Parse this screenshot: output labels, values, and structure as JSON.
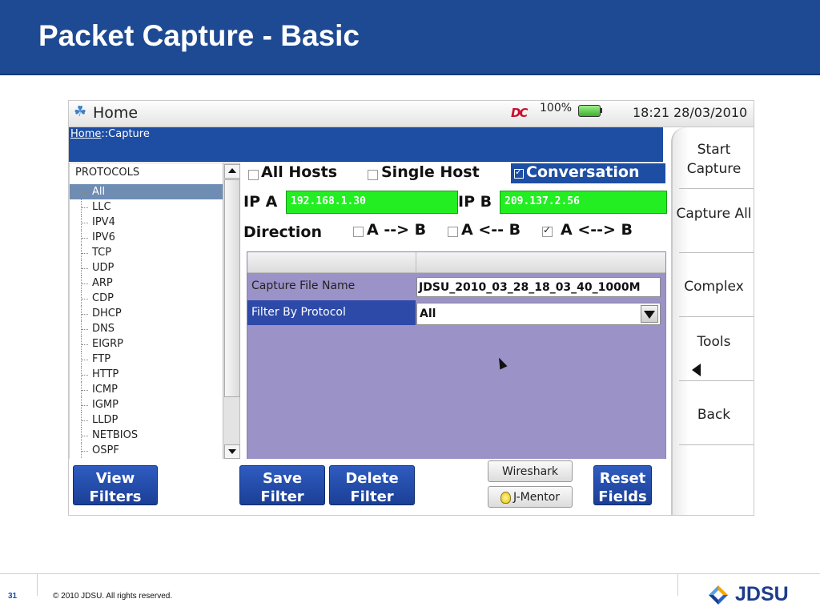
{
  "slide": {
    "title": "Packet Capture - Basic",
    "number": "31",
    "copyright": "© 2010 JDSU. All rights reserved.",
    "logo_text": "JDSU",
    "header_color": "#1d4a93"
  },
  "device": {
    "status_bar": {
      "title": "Home",
      "indicator": "DC",
      "battery": "100%",
      "time": "18:21",
      "date": "28/03/2010"
    },
    "breadcrumb": {
      "home": "Home",
      "rest": "::Capture"
    },
    "protocols": {
      "header": "PROTOCOLS",
      "items": [
        "All",
        "LLC",
        "IPV4",
        "IPV6",
        "TCP",
        "UDP",
        "ARP",
        "CDP",
        "DHCP",
        "DNS",
        "EIGRP",
        "FTP",
        "HTTP",
        "ICMP",
        "IGMP",
        "LLDP",
        "NETBIOS",
        "OSPF"
      ],
      "selected": "All"
    },
    "host_options": {
      "all_hosts": {
        "label": "All Hosts",
        "checked": false
      },
      "single_host": {
        "label": "Single Host",
        "checked": false
      },
      "conversation": {
        "label": "Conversation",
        "checked": true
      }
    },
    "ip": {
      "a_label": "IP A",
      "a_value": "192.168.1.30",
      "b_label": "IP B",
      "b_value": "209.137.2.56"
    },
    "direction": {
      "label": "Direction",
      "a_to_b": {
        "label": "A --> B",
        "checked": false
      },
      "b_to_a": {
        "label": "A <-- B",
        "checked": false
      },
      "both": {
        "label": "A <--> B",
        "checked": true
      }
    },
    "form": {
      "capture_file_label": "Capture File Name",
      "capture_file_value": "JDSU_2010_03_28_18_03_40_1000M",
      "filter_label": "Filter By Protocol",
      "filter_value": "All"
    },
    "side_buttons": {
      "start_capture": "Start\nCapture",
      "capture_all": "Capture\nAll",
      "complex": "Complex",
      "tools": "Tools",
      "back": "Back"
    },
    "bottom_buttons": {
      "view_filters": "View\nFilters",
      "save_filter": "Save\nFilter",
      "delete_filter": "Delete\nFilter",
      "wireshark": "Wireshark",
      "j_mentor": "J-Mentor",
      "reset_fields": "Reset\nFields"
    }
  }
}
